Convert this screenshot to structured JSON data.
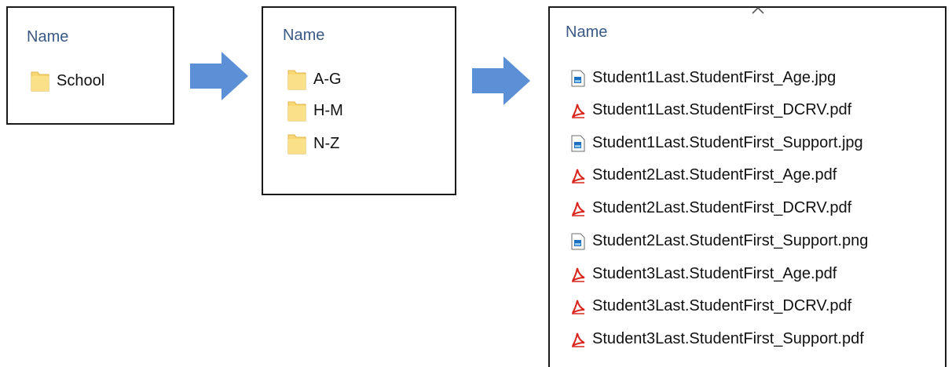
{
  "panels": [
    {
      "column_header": "Name",
      "items": [
        {
          "name": "School",
          "icon": "folder-icon"
        }
      ]
    },
    {
      "column_header": "Name",
      "items": [
        {
          "name": "A-G",
          "icon": "folder-icon"
        },
        {
          "name": "H-M",
          "icon": "folder-icon"
        },
        {
          "name": "N-Z",
          "icon": "folder-icon"
        }
      ]
    },
    {
      "column_header": "Name",
      "sort_indicator": "sort-ascending-caret-icon",
      "items": [
        {
          "name": "Student1Last.StudentFirst_Age.jpg",
          "icon": "image-file-icon"
        },
        {
          "name": "Student1Last.StudentFirst_DCRV.pdf",
          "icon": "pdf-file-icon"
        },
        {
          "name": "Student1Last.StudentFirst_Support.jpg",
          "icon": "image-file-icon"
        },
        {
          "name": "Student2Last.StudentFirst_Age.pdf",
          "icon": "pdf-file-icon"
        },
        {
          "name": "Student2Last.StudentFirst_DCRV.pdf",
          "icon": "pdf-file-icon"
        },
        {
          "name": "Student2Last.StudentFirst_Support.png",
          "icon": "image-file-icon"
        },
        {
          "name": "Student3Last.StudentFirst_Age.pdf",
          "icon": "pdf-file-icon"
        },
        {
          "name": "Student3Last.StudentFirst_DCRV.pdf",
          "icon": "pdf-file-icon"
        },
        {
          "name": "Student3Last.StudentFirst_Support.pdf",
          "icon": "pdf-file-icon"
        }
      ]
    }
  ],
  "arrows": [
    "right-arrow-icon",
    "right-arrow-icon"
  ],
  "colors": {
    "header_text": "#3a5a86",
    "folder_fill": "#f8d775",
    "folder_edge": "#e0b449",
    "arrow_fill": "#5b8fd6",
    "pdf_red": "#d9261c",
    "image_blue": "#1f6fc0",
    "panel_border": "#1a1a1a"
  }
}
